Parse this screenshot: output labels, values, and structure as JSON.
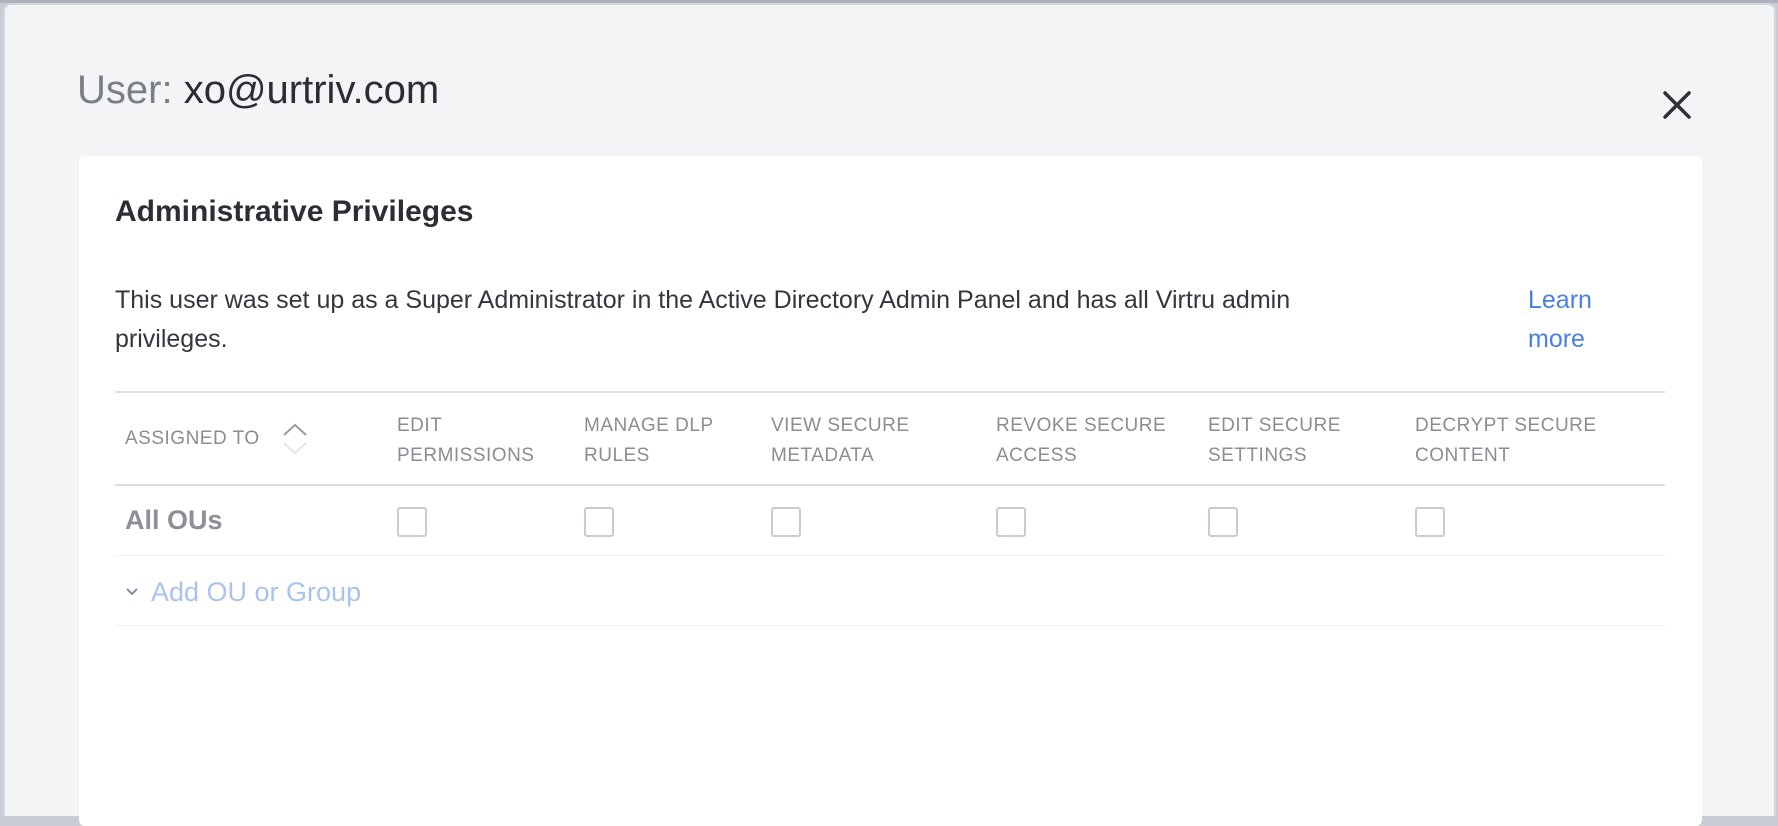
{
  "modal": {
    "title_prefix": "User:",
    "title_email": "xo@urtriv.com",
    "close_icon": "close-icon"
  },
  "card": {
    "title": "Administrative Privileges",
    "description": "This user was set up as a Super Administrator in the Active Directory Admin Panel and has all Virtru admin privileges.",
    "learn_more": "Learn more"
  },
  "table": {
    "assigned_header": "ASSIGNED TO",
    "sort_icon": "sort-arrows-icon",
    "columns": [
      {
        "line1": "EDIT",
        "line2": "PERMISSIONS"
      },
      {
        "line1": "MANAGE DLP",
        "line2": "RULES"
      },
      {
        "line1": "VIEW SECURE",
        "line2": "METADATA"
      },
      {
        "line1": "REVOKE SECURE",
        "line2": "ACCESS"
      },
      {
        "line1": "EDIT SECURE",
        "line2": "SETTINGS"
      },
      {
        "line1": "DECRYPT SECURE",
        "line2": "CONTENT"
      }
    ],
    "rows": [
      {
        "label": "All OUs",
        "checked": [
          false,
          false,
          false,
          false,
          false,
          false
        ]
      }
    ],
    "add_label": "Add OU or Group",
    "add_icon": "chevron-down-icon"
  },
  "colors": {
    "accent_link": "#4a7fe0",
    "disabled_link": "#a9c2ef",
    "modal_bg": "#f3f4f6",
    "card_bg": "#ffffff"
  }
}
